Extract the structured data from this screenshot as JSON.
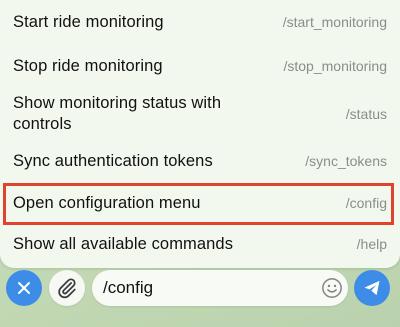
{
  "commands": [
    {
      "label": "Start ride monitoring",
      "command": "/start_monitoring"
    },
    {
      "label": "Stop ride monitoring",
      "command": "/stop_monitoring"
    },
    {
      "label": "Show monitoring status with controls",
      "command": "/status"
    },
    {
      "label": "Sync authentication tokens",
      "command": "/sync_tokens"
    },
    {
      "label": "Open configuration menu",
      "command": "/config",
      "highlighted": true
    },
    {
      "label": "Show all available commands",
      "command": "/help"
    }
  ],
  "input": {
    "value": "/config"
  },
  "icons": {
    "close": "close-icon",
    "attach": "paperclip-icon",
    "emoji": "smiley-icon",
    "send": "send-icon"
  },
  "colors": {
    "accent": "#3d8de8",
    "highlight": "#e0432d",
    "panel_bg": "#f3f8ef"
  }
}
